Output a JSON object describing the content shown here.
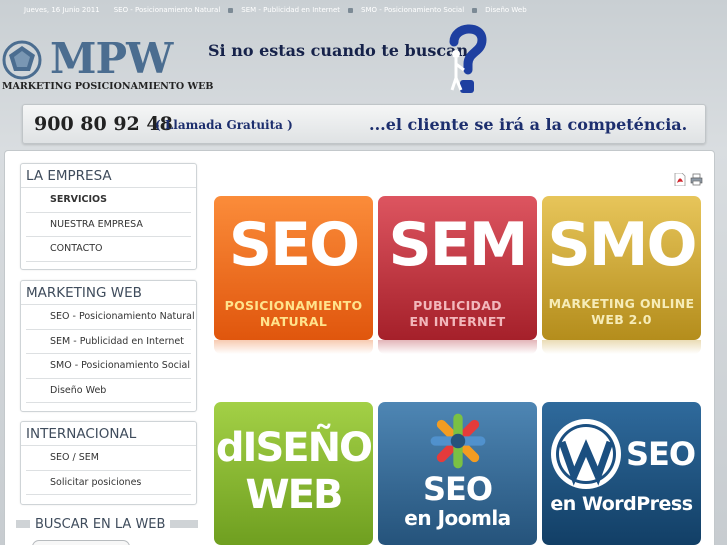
{
  "topnav": {
    "date": "Jueves, 16 Junio 2011",
    "items": [
      "SEO - Posicionamiento Natural",
      "SEM - Publicidad en Internet",
      "SMO - Posicionamiento Social",
      "Diseño Web"
    ]
  },
  "header": {
    "logo": "MPW",
    "logo_sub": "MARKETING POSICIONAMIENTO WEB",
    "tagline": "Si no estas cuando te buscan"
  },
  "phonebar": {
    "phone": "900 80 92 48",
    "free_call": "( Llamada Gratuita )",
    "message": "...el cliente se irá a  la competéncia."
  },
  "sidebar": {
    "empresa": {
      "title": "LA EMPRESA",
      "items": [
        "SERVICIOS",
        "NUESTRA EMPRESA",
        "CONTACTO"
      ]
    },
    "marketing": {
      "title": "MARKETING WEB",
      "items": [
        "SEO - Posicionamiento Natural",
        "SEM - Publicidad en Internet",
        "SMO - Posicionamiento Social",
        "Diseño Web"
      ]
    },
    "internacional": {
      "title": "INTERNACIONAL",
      "items": [
        "SEO / SEM",
        "Solicitar posiciones"
      ]
    },
    "search_title": "BUSCAR EN LA WEB"
  },
  "tiles": {
    "seo": {
      "big": "SEO",
      "sub1": "POSICIONAMIENTO",
      "sub2": "NATURAL"
    },
    "sem": {
      "big": "SEM",
      "sub1": "PUBLICIDAD",
      "sub2": "EN INTERNET"
    },
    "smo": {
      "big": "SMO",
      "sub1": "MARKETING ONLINE",
      "sub2": "WEB 2.0"
    },
    "diseno": {
      "line1": "dISEÑO",
      "line2": "WEB"
    },
    "joomla": {
      "line1": "SEO",
      "line2": "en Joomla"
    },
    "wordpress": {
      "line1": "SEO",
      "line2": "en WordPress"
    }
  },
  "colors": {
    "brand_blue": "#4b6d90",
    "seo_orange": "#f07a2a",
    "sem_red": "#c43a44",
    "smo_gold": "#d2ac3a",
    "diseno_green": "#8bbb32",
    "joomla_blue": "#3a6f9b",
    "wordpress_blue": "#1f5486"
  },
  "icons": [
    "logo-emblem-icon",
    "question-mark-figure-icon",
    "pdf-icon",
    "print-icon",
    "joomla-logo-icon",
    "wordpress-logo-icon"
  ]
}
